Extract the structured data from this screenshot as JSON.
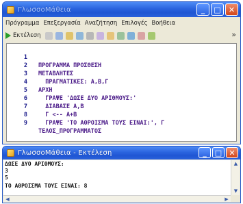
{
  "main_window": {
    "title": "ΓλωσσοΜάθεια",
    "menu": [
      "Πρόγραμμα",
      "Επεξεργασία",
      "Αναζήτηση",
      "Επιλογές",
      "Βοήθεια"
    ],
    "toolbar": {
      "run_label": "Εκτέλεση",
      "icons": [
        "new-file-icon",
        "open-icon",
        "save-icon",
        "print-icon",
        "cut-icon",
        "copy-icon",
        "paste-icon",
        "undo-icon",
        "redo-icon",
        "find-icon",
        "replace-icon"
      ]
    }
  },
  "editor": {
    "lines": [
      {
        "n": "1",
        "text": "ΠΡΟΓΡΑΜΜΑ ΠΡΟΣΘΕΣΗ"
      },
      {
        "n": "2",
        "text": "ΜΕΤΑΒΛΗΤΕΣ"
      },
      {
        "n": "3",
        "text": "  ΠΡΑΓΜΑΤΙΚΕΣ: Α,Β,Γ"
      },
      {
        "n": "4",
        "text": "ΑΡΧΗ"
      },
      {
        "n": "5",
        "text": "  ΓΡΑΨΕ 'ΔΩΣΕ ΔΥΟ ΑΡΙΘΜΟΥΣ:'"
      },
      {
        "n": "6",
        "text": "  ΔΙΑΒΑΣΕ Α,Β"
      },
      {
        "n": "7",
        "text": "  Γ <-- Α+Β"
      },
      {
        "n": "8",
        "text": "  ΓΡΑΨΕ 'ΤΟ ΑΘΡΟΙΣΜΑ ΤΟΥΣ ΕΙΝΑΙ:', Γ"
      },
      {
        "n": "9",
        "text": "ΤΕΛΟΣ_ΠΡΟΓΡΑΜΜΑΤΟΣ"
      }
    ]
  },
  "console_window": {
    "title": "ΓλωσσοΜάθεια - Εκτέλεση",
    "output": [
      "ΔΩΣΕ ΔΥΟ ΑΡΙΘΜΟΥΣ:",
      "3",
      "5",
      "ΤΟ ΑΘΡΟΙΣΜΑ ΤΟΥΣ ΕΙΝΑΙ: 8"
    ]
  },
  "colors": {
    "titlebar": "#2a63de",
    "keyword": "#4a1a88",
    "line_number": "#1a1a8a",
    "run_green": "#2a9d2a"
  }
}
